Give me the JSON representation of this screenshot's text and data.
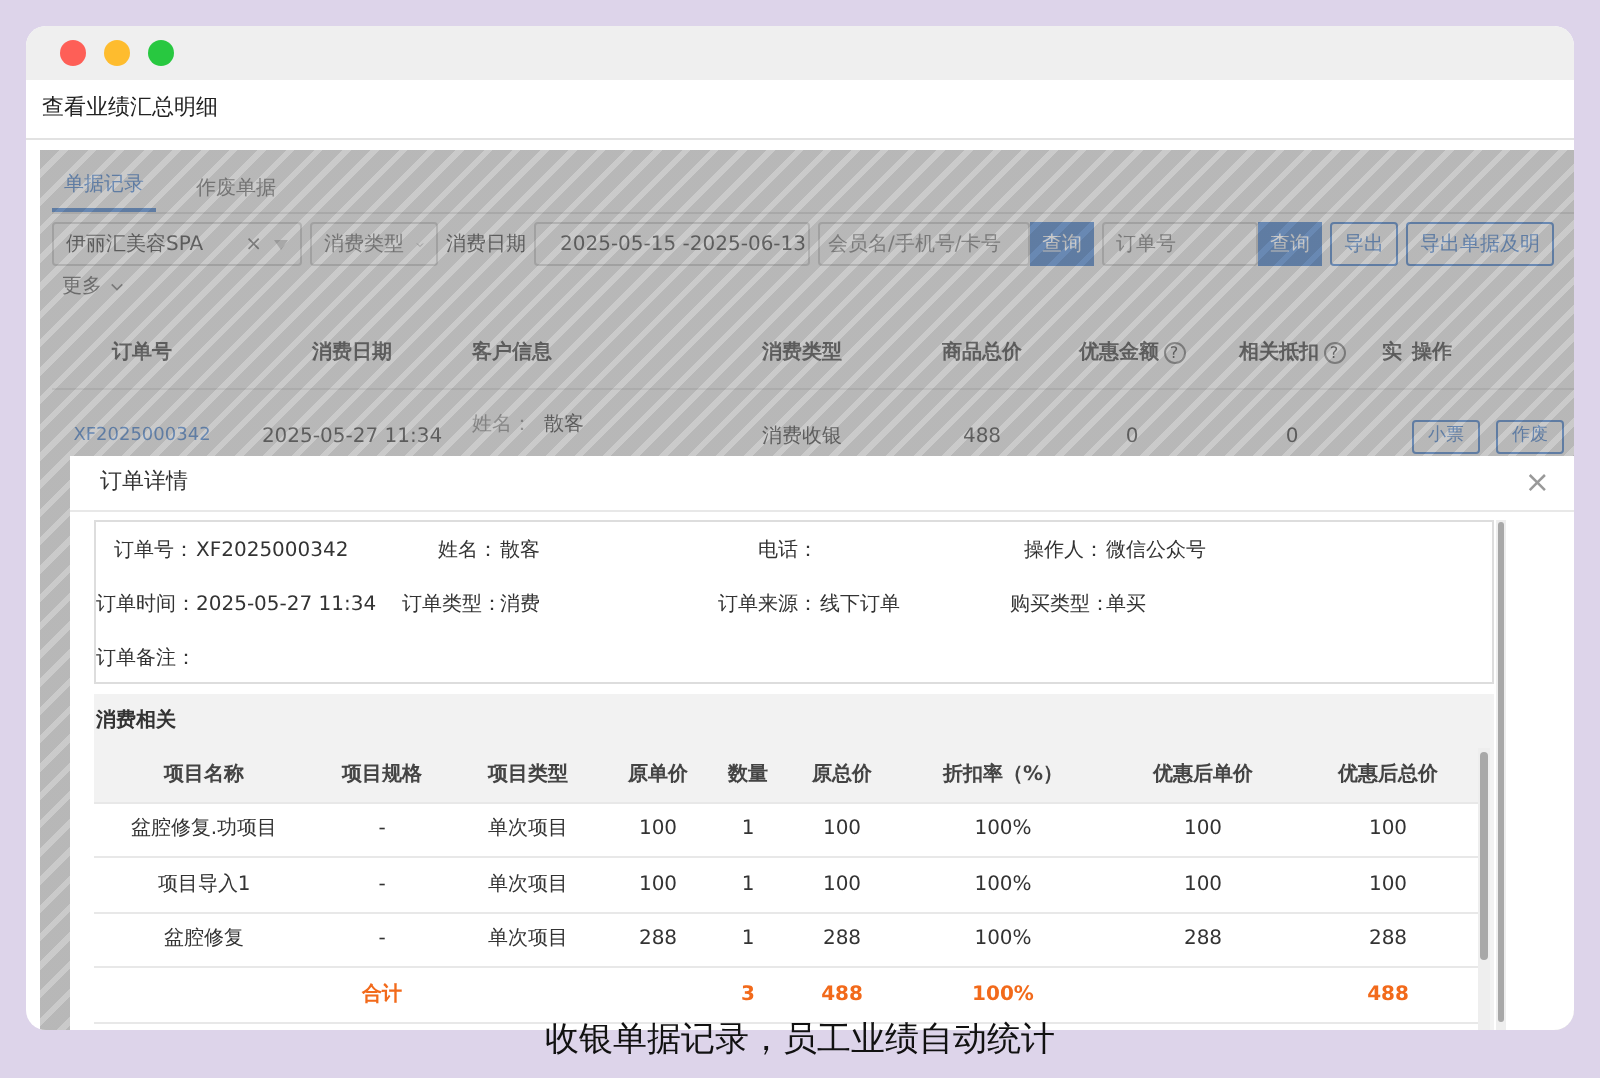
{
  "window": {
    "title": "查看业绩汇总明细"
  },
  "tabs": [
    {
      "label": "单据记录",
      "selected": true
    },
    {
      "label": "作废单据",
      "selected": false
    }
  ],
  "filters": {
    "store_select": {
      "value": "伊丽汇美容SPA",
      "clear": "×"
    },
    "type_select": {
      "placeholder": "消费类型"
    },
    "date_label": "消费日期",
    "date_range": "2025-05-15 -2025-06-13",
    "member_search": {
      "placeholder": "会员名/手机号/卡号",
      "button": "查询"
    },
    "order_search": {
      "placeholder": "订单号",
      "button": "查询"
    },
    "buttons": [
      "导出",
      "导出单据及明"
    ],
    "more": "更多"
  },
  "orders_table": {
    "columns": [
      {
        "label": "订单号"
      },
      {
        "label": "消费日期"
      },
      {
        "label": "客户信息"
      },
      {
        "label": "消费类型"
      },
      {
        "label": "商品总价"
      },
      {
        "label": "优惠金额",
        "help": "?"
      },
      {
        "label": "相关抵扣",
        "help": "?"
      },
      {
        "label": "实"
      },
      {
        "label": "操作"
      }
    ],
    "rows": [
      {
        "order_no": "XF2025000342",
        "date": "2025-05-27 11:34",
        "customer_label": "姓名：",
        "customer": "散客",
        "type": "消费收银",
        "total": "488",
        "discount": "0",
        "deduction": "0",
        "actions": [
          "小票",
          "作废"
        ]
      }
    ]
  },
  "modal": {
    "title": "订单详情",
    "close": "×",
    "info_rows": [
      [
        {
          "label": "订单号：",
          "value": "XF2025000342"
        },
        {
          "label": "姓名：",
          "value": "散客"
        },
        {
          "label": "电话："
        },
        {
          "label": "操作人：",
          "value": "微信公众号"
        }
      ],
      [
        {
          "label": "订单时间：",
          "value": "2025-05-27 11:34"
        },
        {
          "label": "订单类型：",
          "value": "消费"
        },
        {
          "label": "订单来源：",
          "value": "线下订单"
        },
        {
          "label": "购买类型：",
          "value": "单买"
        }
      ],
      [
        {
          "label": "订单备注："
        }
      ]
    ],
    "section_title": "消费相关",
    "items_table": {
      "columns": [
        "项目名称",
        "项目规格",
        "项目类型",
        "原单价",
        "数量",
        "原总价",
        "折扣率（%）",
        "优惠后单价",
        "优惠后总价"
      ],
      "rows": [
        [
          "盆腔修复.功项目",
          "-",
          "单次项目",
          "100",
          "1",
          "100",
          "100%",
          "100",
          "100"
        ],
        [
          "项目导入1",
          "-",
          "单次项目",
          "100",
          "1",
          "100",
          "100%",
          "100",
          "100"
        ],
        [
          "盆腔修复",
          "-",
          "单次项目",
          "288",
          "1",
          "288",
          "100%",
          "288",
          "288"
        ]
      ],
      "total": {
        "label": "合计",
        "quantity": "3",
        "original_total": "488",
        "discount_rate": "100%",
        "final_total": "488"
      }
    }
  },
  "caption": "收银单据记录，员工业绩自动统计"
}
